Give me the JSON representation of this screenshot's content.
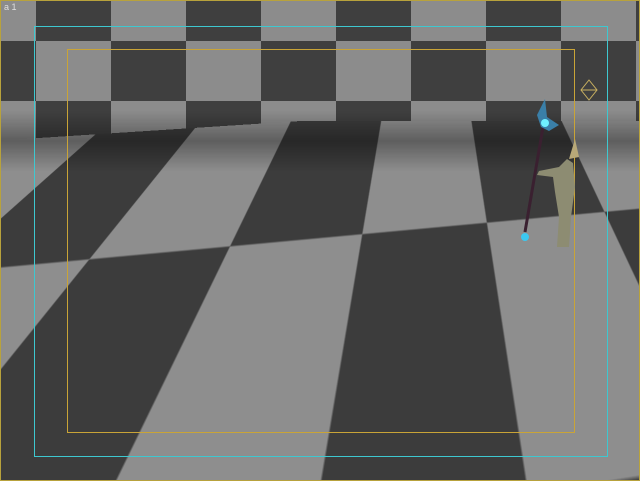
{
  "viewport": {
    "label": "a 1",
    "colors": {
      "checker_dark": "#3c3c3c",
      "checker_light": "#8e8e8e",
      "safe_frame_outer": "#3ec8d0",
      "safe_frame_inner": "#c9a437",
      "border": "#b8a23c"
    }
  }
}
